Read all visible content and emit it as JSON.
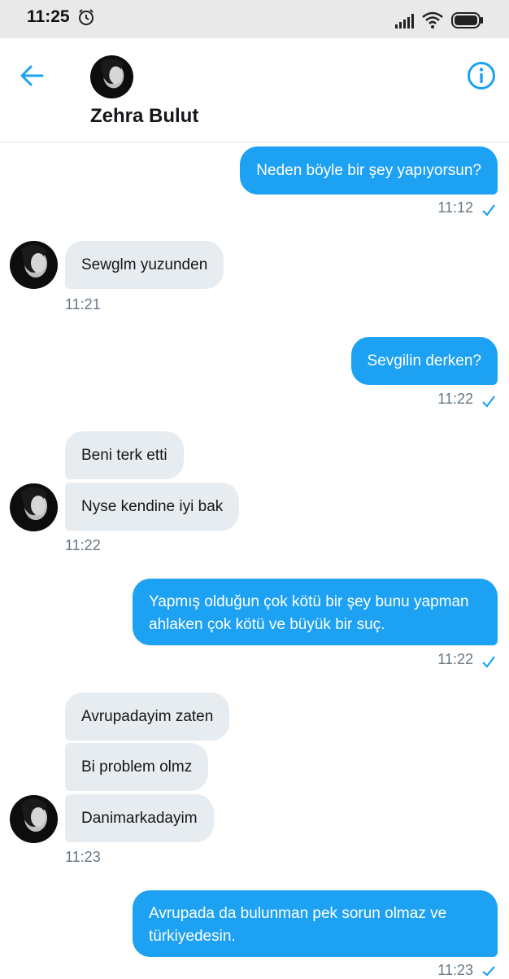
{
  "status_bar": {
    "time": "11:25"
  },
  "header": {
    "contact_name": "Zehra Bulut"
  },
  "icons": {
    "alarm": "alarm-clock-icon",
    "signal": "signal-strength-icon",
    "wifi": "wifi-icon",
    "battery": "battery-icon",
    "back": "back-arrow-icon",
    "info": "info-icon",
    "read": "checkmark-icon"
  },
  "colors": {
    "accent": "#1da1f2",
    "incoming_bubble": "#e6ecf0",
    "meta_text": "#657786"
  },
  "messages": [
    {
      "direction": "out",
      "text": "Neden böyle bir şey yapıyorsun?",
      "time": "11:12"
    },
    {
      "direction": "in",
      "text": "Sewglm yuzunden",
      "time": "11:21"
    },
    {
      "direction": "out",
      "text": "Sevgilin derken?",
      "time": "11:22"
    },
    {
      "direction": "in",
      "text": "Beni terk etti"
    },
    {
      "direction": "in",
      "text": "Nyse kendine iyi bak",
      "time": "11:22"
    },
    {
      "direction": "out",
      "text": "Yapmış olduğun çok kötü bir şey bunu yapman ahlaken çok kötü ve büyük bir suç.",
      "time": "11:22"
    },
    {
      "direction": "in",
      "text": "Avrupadayim zaten"
    },
    {
      "direction": "in",
      "text": "Bi problem olmz"
    },
    {
      "direction": "in",
      "text": "Danimarkadayim",
      "time": "11:23"
    },
    {
      "direction": "out",
      "text": "Avrupada da bulunman pek sorun olmaz ve türkiyedesin.",
      "time": "11:23"
    }
  ]
}
